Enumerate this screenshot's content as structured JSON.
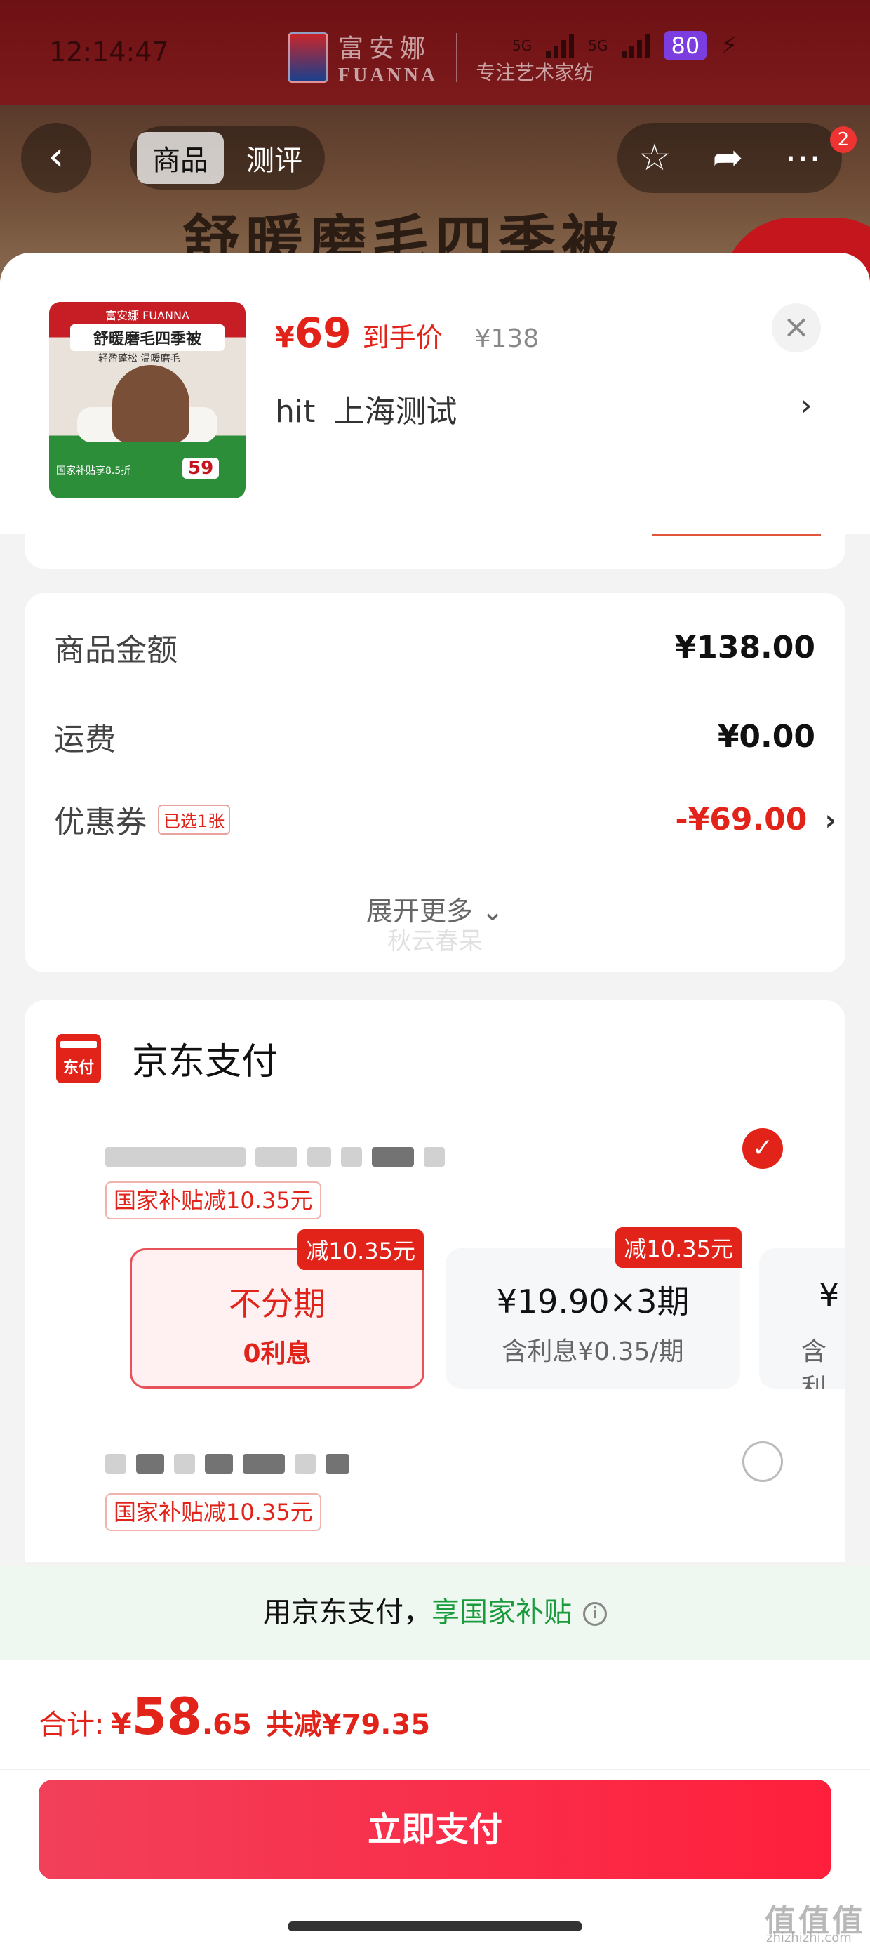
{
  "status_bar": {
    "time": "12:14:47",
    "brand_cn": "富安娜",
    "brand_en": "FUANNA",
    "brand_slogan": "专注艺术家纺",
    "network_1": "5G",
    "network_2": "5G",
    "battery": "80"
  },
  "nav": {
    "back_icon": "chevron-left",
    "tabs": [
      {
        "label": "商品"
      },
      {
        "label": "测评"
      }
    ],
    "actions": [
      "star-icon",
      "share-icon",
      "more-icon"
    ],
    "badge": "2",
    "banner_title": "舒暖磨毛四季被"
  },
  "product": {
    "thumb": {
      "brand": "富安娜 FUANNA",
      "title": "舒暖磨毛四季被",
      "sub": "轻盈蓬松 温暖磨毛",
      "promo": "国家补贴享8.5折",
      "price": "59"
    },
    "price_symbol": "¥",
    "price": "69",
    "price_tag": "到手价",
    "original_price": "¥138",
    "address_name": "hit",
    "address_place": "上海测试"
  },
  "summary": {
    "rows": [
      {
        "label": "商品金额",
        "value": "¥138.00"
      },
      {
        "label": "运费",
        "value": "¥0.00"
      },
      {
        "label": "优惠券",
        "badge": "已选1张",
        "value": "-¥69.00"
      }
    ],
    "expand_label": "展开更多",
    "watermark": "秋云春呆"
  },
  "payment": {
    "method_title": "京东支付",
    "logo_text": "东付",
    "subsidy_label": "国家补贴减10.35元",
    "plans": [
      {
        "title": "不分期",
        "sub": "0利息",
        "badge": "减10.35元",
        "selected": true
      },
      {
        "title": "¥19.90×3期",
        "sub": "含利息¥0.35/期",
        "badge": "减10.35元",
        "selected": false
      },
      {
        "title": "¥",
        "sub": "含利",
        "badge": "",
        "selected": false
      }
    ]
  },
  "notice": {
    "text": "用京东支付，",
    "highlight": "享国家补贴",
    "info_icon": "i"
  },
  "footer": {
    "total_label": "合计:",
    "total_symbol": "¥",
    "total_int": "58",
    "total_dec": ".65",
    "total_discount": "共减¥79.35",
    "pay_button": "立即支付",
    "corner_mark": "值值值",
    "corner_sub": "zhizhizhi.com"
  },
  "colors": {
    "accent_red": "#e2231a",
    "subsidy_green": "#1a9b3c"
  }
}
